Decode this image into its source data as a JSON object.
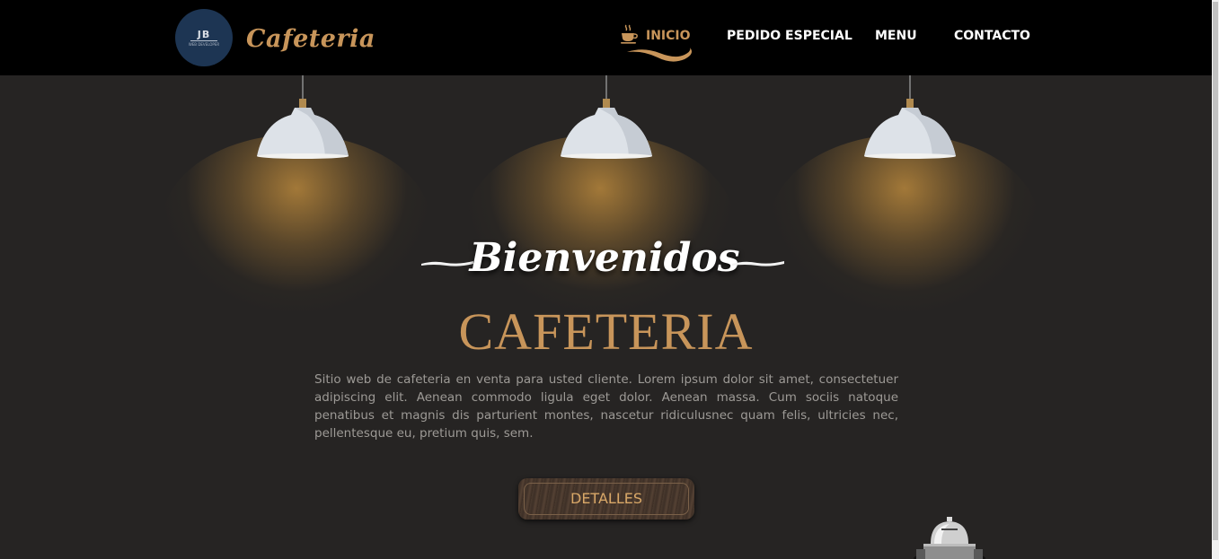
{
  "header": {
    "logo": {
      "initials": "JB",
      "subtitle": "WEB DEVELOPER"
    },
    "brand": "Cafeteria",
    "nav": [
      {
        "label": "INICIO",
        "active": true
      },
      {
        "label": "PEDIDO ESPECIAL",
        "active": false
      },
      {
        "label": "MENU",
        "active": false
      },
      {
        "label": "CONTACTO",
        "active": false
      }
    ],
    "icons": {
      "active_nav": "coffee-cup-icon",
      "underline": "swash-underline-icon"
    }
  },
  "hero": {
    "welcome": "Bienvenidos",
    "title": "CAFETERIA",
    "description": "Sitio web de cafeteria en venta para usted cliente. Lorem ipsum dolor sit amet, consectetuer adipiscing elit. Aenean commodo ligula eget dolor. Aenean massa. Cum sociis natoque penatibus et magnis dis parturient montes, nascetur ridiculusnec quam felis, ultricies nec, pellentesque eu, pretium quis, sem.",
    "button_label": "DETALLES",
    "decor": [
      "pendant-lamp-icon",
      "pendant-lamp-icon",
      "pendant-lamp-icon",
      "coffee-machine-icon"
    ]
  },
  "colors": {
    "accent": "#c8955a",
    "background": "#262423",
    "navbar": "#000000",
    "text_muted": "#9d9a96"
  }
}
